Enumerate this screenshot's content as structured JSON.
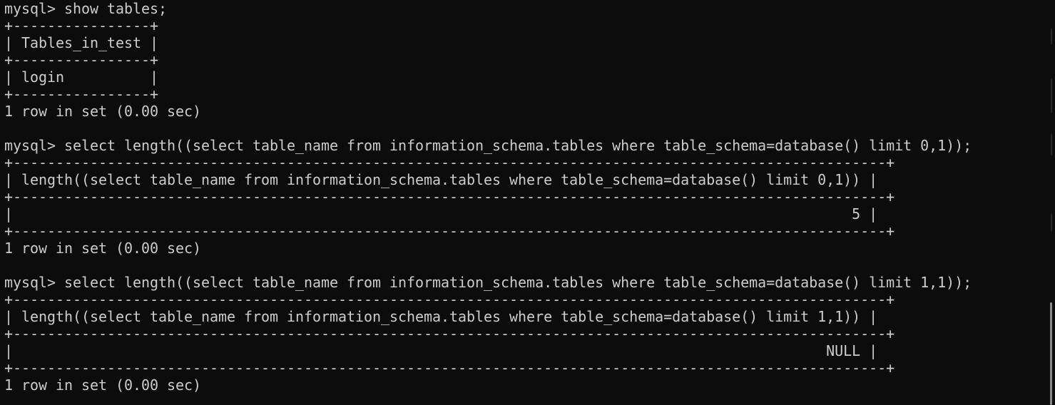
{
  "terminal": {
    "lines": [
      "mysql> show tables;",
      "+----------------+",
      "| Tables_in_test |",
      "+----------------+",
      "| login          |",
      "+----------------+",
      "1 row in set (0.00 sec)",
      "",
      "mysql> select length((select table_name from information_schema.tables where table_schema=database() limit 0,1));",
      "+------------------------------------------------------------------------------------------------------+",
      "| length((select table_name from information_schema.tables where table_schema=database() limit 0,1)) |",
      "+------------------------------------------------------------------------------------------------------+",
      "|                                                                                                  5 |",
      "+------------------------------------------------------------------------------------------------------+",
      "1 row in set (0.00 sec)",
      "",
      "mysql> select length((select table_name from information_schema.tables where table_schema=database() limit 1,1));",
      "+------------------------------------------------------------------------------------------------------+",
      "| length((select table_name from information_schema.tables where table_schema=database() limit 1,1)) |",
      "+------------------------------------------------------------------------------------------------------+",
      "|                                                                                               NULL |",
      "+------------------------------------------------------------------------------------------------------+",
      "1 row in set (0.00 sec)"
    ]
  },
  "colors": {
    "background": "#0c0c0c",
    "text": "#cccccc",
    "scroll_thumb": "#8a8a8a"
  }
}
